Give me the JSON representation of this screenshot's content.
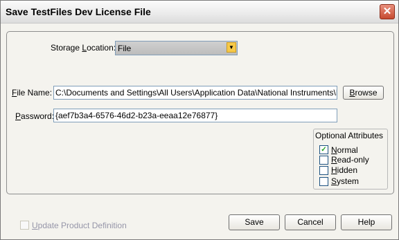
{
  "window": {
    "title": "Save TestFiles Dev License File",
    "close_glyph": "✕"
  },
  "storage": {
    "label_pre": "Storage ",
    "label_ul": "L",
    "label_post": "ocation:",
    "value": "File",
    "arrow": "▼"
  },
  "file_name": {
    "label_ul": "F",
    "label_post": "ile Name:",
    "value": "C:\\Documents and Settings\\All Users\\Application Data\\National Instruments\\Partner"
  },
  "browse": {
    "label_ul": "B",
    "label_post": "rowse"
  },
  "password": {
    "label_ul": "P",
    "label_post": "assword:",
    "value": "{aef7b3a4-6576-46d2-b23a-eeaa12e76877}"
  },
  "attributes": {
    "title": "Optional Attributes",
    "items": [
      {
        "ul": "N",
        "rest": "ormal",
        "checked": true
      },
      {
        "ul": "R",
        "rest": "ead-only",
        "checked": false
      },
      {
        "ul": "H",
        "rest": "idden",
        "checked": false
      },
      {
        "ul": "S",
        "rest": "ystem",
        "checked": false
      }
    ],
    "check_glyph": "✓"
  },
  "update_product": {
    "ul": "U",
    "rest": "pdate Product Definition",
    "checked": false,
    "enabled": false
  },
  "buttons": {
    "save": "Save",
    "cancel": "Cancel",
    "help": "Help"
  }
}
